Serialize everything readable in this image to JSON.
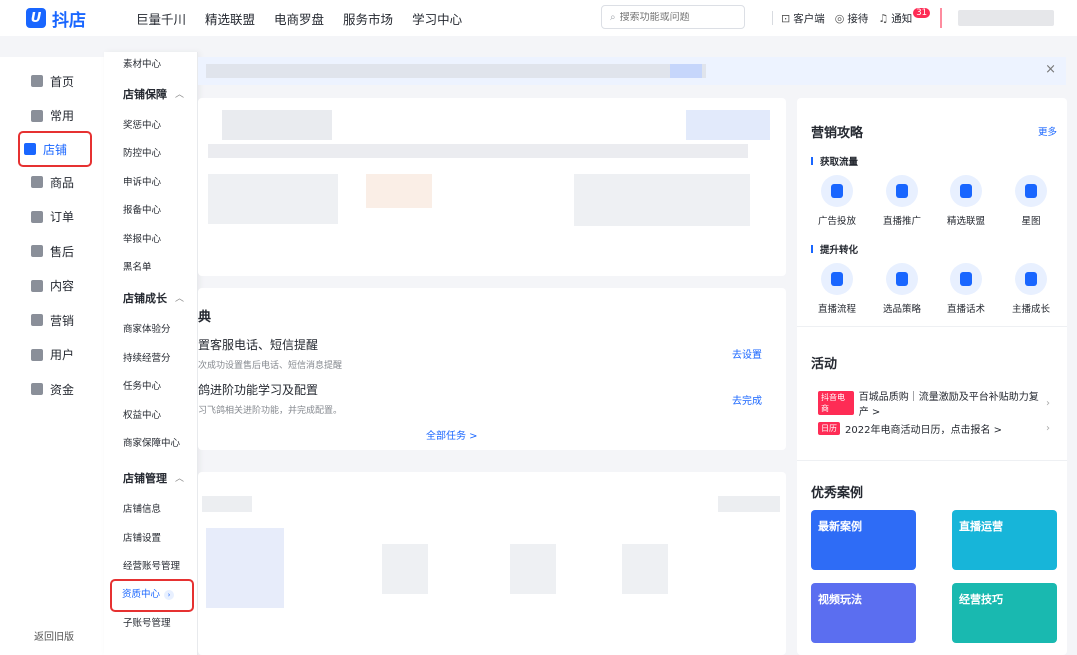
{
  "brand": {
    "logo_glyph": "U",
    "name": "抖店",
    "color": "#1966ff"
  },
  "topnav": [
    "巨量千川",
    "精选联盟",
    "电商罗盘",
    "服务市场",
    "学习中心"
  ],
  "search": {
    "placeholder": "搜索功能或问题"
  },
  "top_right": {
    "client": "客户端",
    "reception": "接待",
    "notice": "通知",
    "notice_count": "31"
  },
  "sidebar": {
    "items": [
      {
        "label": "首页",
        "icon": "home-icon"
      },
      {
        "label": "常用",
        "icon": "apps-icon"
      },
      {
        "label": "店铺",
        "icon": "shop-icon",
        "active": true
      },
      {
        "label": "商品",
        "icon": "bag-icon"
      },
      {
        "label": "订单",
        "icon": "list-icon"
      },
      {
        "label": "售后",
        "icon": "box-icon"
      },
      {
        "label": "内容",
        "icon": "content-icon"
      },
      {
        "label": "营销",
        "icon": "megaphone-icon"
      },
      {
        "label": "用户",
        "icon": "user-icon"
      },
      {
        "label": "资金",
        "icon": "wallet-icon"
      }
    ],
    "footer": "返回旧版"
  },
  "submenu": {
    "top_link": "素材中心",
    "groups": [
      {
        "title": "店铺保障",
        "links": [
          "奖惩中心",
          "防控中心",
          "申诉中心",
          "报备中心",
          "举报中心",
          "黑名单"
        ]
      },
      {
        "title": "店铺成长",
        "links": [
          "商家体验分",
          "持续经营分",
          "任务中心",
          "权益中心",
          "商家保障中心"
        ]
      },
      {
        "title": "店铺管理",
        "links": [
          "店铺信息",
          "店铺设置",
          "经营账号管理",
          "资质中心",
          "子账号管理"
        ]
      }
    ]
  },
  "tasks": {
    "section_title": "典",
    "items": [
      {
        "title": "置客服电话、短信提醒",
        "desc": "次成功设置售后电话、短信消息提醒",
        "action": "去设置"
      },
      {
        "title": "鸽进阶功能学习及配置",
        "desc": "习飞鸽相关进阶功能，并完成配置。",
        "action": "去完成"
      }
    ],
    "all_tasks": "全部任务 >"
  },
  "marketing": {
    "title": "营销攻略",
    "more": "更多",
    "sub1": "获取流量",
    "row1": [
      "广告投放",
      "直播推广",
      "精选联盟",
      "星图"
    ],
    "sub2": "提升转化",
    "row2": [
      "直播流程",
      "选品策略",
      "直播话术",
      "主播成长"
    ]
  },
  "activities": {
    "title": "活动",
    "items": [
      {
        "tag": "抖音电商",
        "text": "百城品质购｜流量激励及平台补贴助力复产 >"
      },
      {
        "tag": "日历",
        "text": "2022年电商活动日历，点击报名 >"
      }
    ]
  },
  "cases": {
    "title": "优秀案例",
    "items": [
      {
        "label": "最新案例",
        "color": "#2e6cf6"
      },
      {
        "label": "直播运营",
        "color": "#17b5d9"
      },
      {
        "label": "视频玩法",
        "color": "#5b6ef0"
      },
      {
        "label": "经营技巧",
        "color": "#19b9b0"
      }
    ]
  }
}
